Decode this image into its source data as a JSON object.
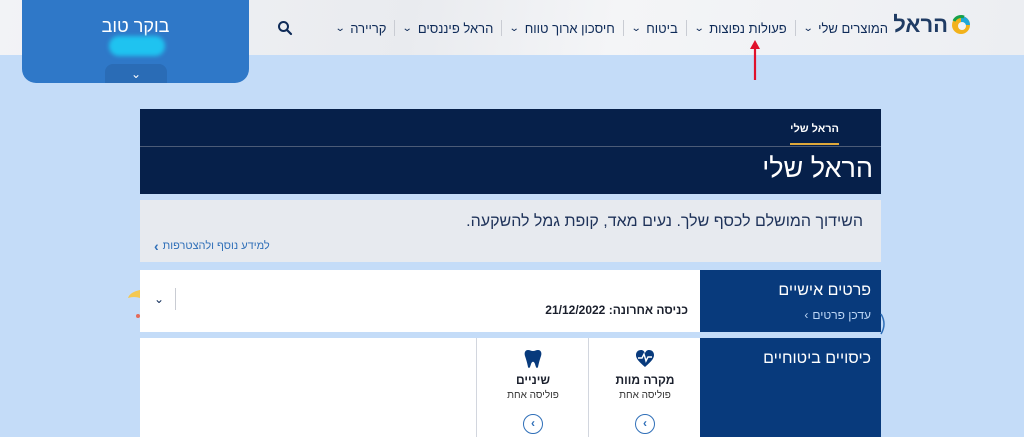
{
  "logo": {
    "text": "הראל"
  },
  "nav": {
    "items": [
      {
        "label": "המוצרים שלי"
      },
      {
        "label": "פעולות נפוצות"
      },
      {
        "label": "ביטוח"
      },
      {
        "label": "חיסכון ארוך טווח"
      },
      {
        "label": "הראל פיננסים"
      },
      {
        "label": "קריירה"
      }
    ]
  },
  "greeting": {
    "text": "בוקר טוב"
  },
  "hero": {
    "subtitle": "הראל שלי",
    "title": "הראל שלי"
  },
  "promo": {
    "text": "השידוך המושלם לכסף שלך. נעים מאד, קופת גמל להשקעה.",
    "link": "למידע נוסף ולהצטרפות"
  },
  "personal": {
    "title": "פרטים אישיים",
    "update_link": "עדכן פרטים",
    "last_login": "כניסה אחרונה: 21/12/2022"
  },
  "coverage": {
    "title": "כיסויים ביטוחיים",
    "cards": [
      {
        "label": "מקרה מוות",
        "count": "פוליסה אחת",
        "icon": "heart-pulse-icon"
      },
      {
        "label": "שיניים",
        "count": "פוליסה אחת",
        "icon": "tooth-icon"
      }
    ]
  },
  "colors": {
    "navy": "#06204a",
    "blue": "#083a7c",
    "accent": "#2f78c8",
    "gold": "#e0a93a",
    "arrow": "#e0112b"
  }
}
